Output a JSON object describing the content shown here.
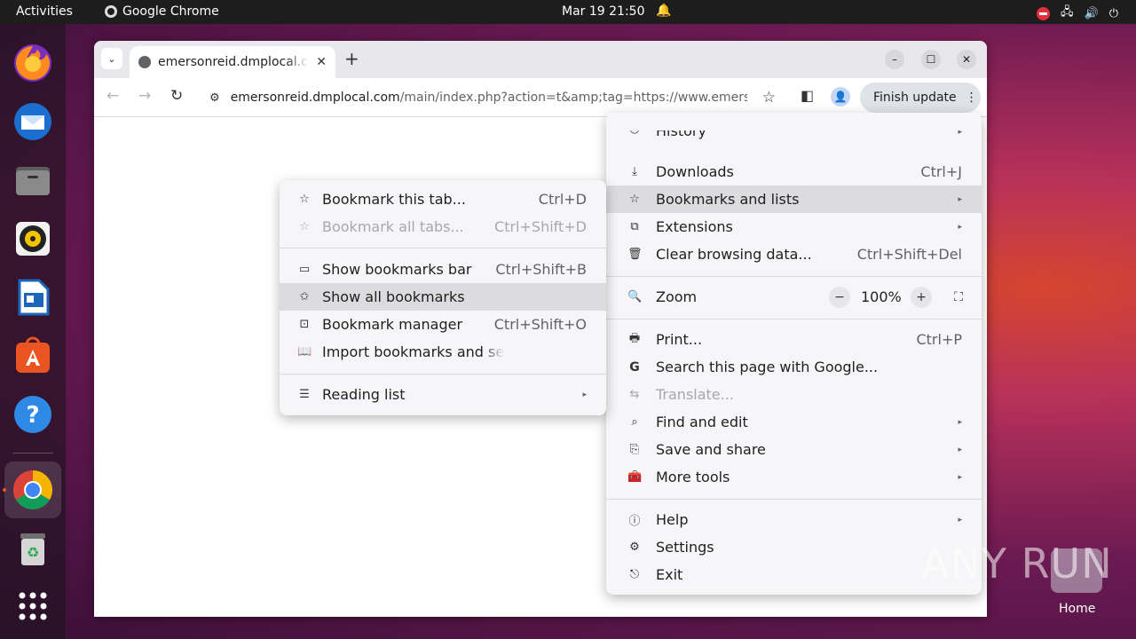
{
  "topbar": {
    "activities": "Activities",
    "app_name": "Google Chrome",
    "clock": "Mar 19  21:50"
  },
  "dock": {
    "items": [
      "firefox-icon",
      "thunderbird-icon",
      "files-icon",
      "rhythmbox-icon",
      "writer-icon",
      "software-icon",
      "help-icon",
      "chrome-icon",
      "trash-icon",
      "apps-grid-icon"
    ]
  },
  "browser": {
    "tab_title": "emersonreid.dmplocal.com",
    "url_host": "emersonreid.dmplocal.com",
    "url_path": "/main/index.php?action=t&amp;tag=https://www.emersonreid....",
    "finish_update": "Finish update"
  },
  "main_menu": {
    "partial_top": "History",
    "items": [
      {
        "label": "Downloads",
        "shortcut": "Ctrl+J"
      },
      {
        "label": "Bookmarks and lists"
      },
      {
        "label": "Extensions"
      },
      {
        "label": "Clear browsing data...",
        "shortcut": "Ctrl+Shift+Del"
      },
      {
        "label": "Zoom"
      },
      {
        "label": "Print...",
        "shortcut": "Ctrl+P"
      },
      {
        "label": "Search this page with Google..."
      },
      {
        "label": "Translate..."
      },
      {
        "label": "Find and edit"
      },
      {
        "label": "Save and share"
      },
      {
        "label": "More tools"
      },
      {
        "label": "Help"
      },
      {
        "label": "Settings"
      },
      {
        "label": "Exit"
      }
    ],
    "zoom": {
      "minus": "−",
      "value": "100%",
      "plus": "+"
    }
  },
  "bookmarks_menu": {
    "items": [
      {
        "label": "Bookmark this tab...",
        "shortcut": "Ctrl+D"
      },
      {
        "label": "Bookmark all tabs...",
        "shortcut": "Ctrl+Shift+D"
      },
      {
        "label": "Show bookmarks bar",
        "shortcut": "Ctrl+Shift+B"
      },
      {
        "label": "Show all bookmarks"
      },
      {
        "label": "Bookmark manager",
        "shortcut": "Ctrl+Shift+O"
      },
      {
        "label": "Import bookmarks and se"
      },
      {
        "label": "Reading list"
      }
    ]
  },
  "watermark": "ANY RUN",
  "desktop": {
    "home_label": "Home"
  }
}
